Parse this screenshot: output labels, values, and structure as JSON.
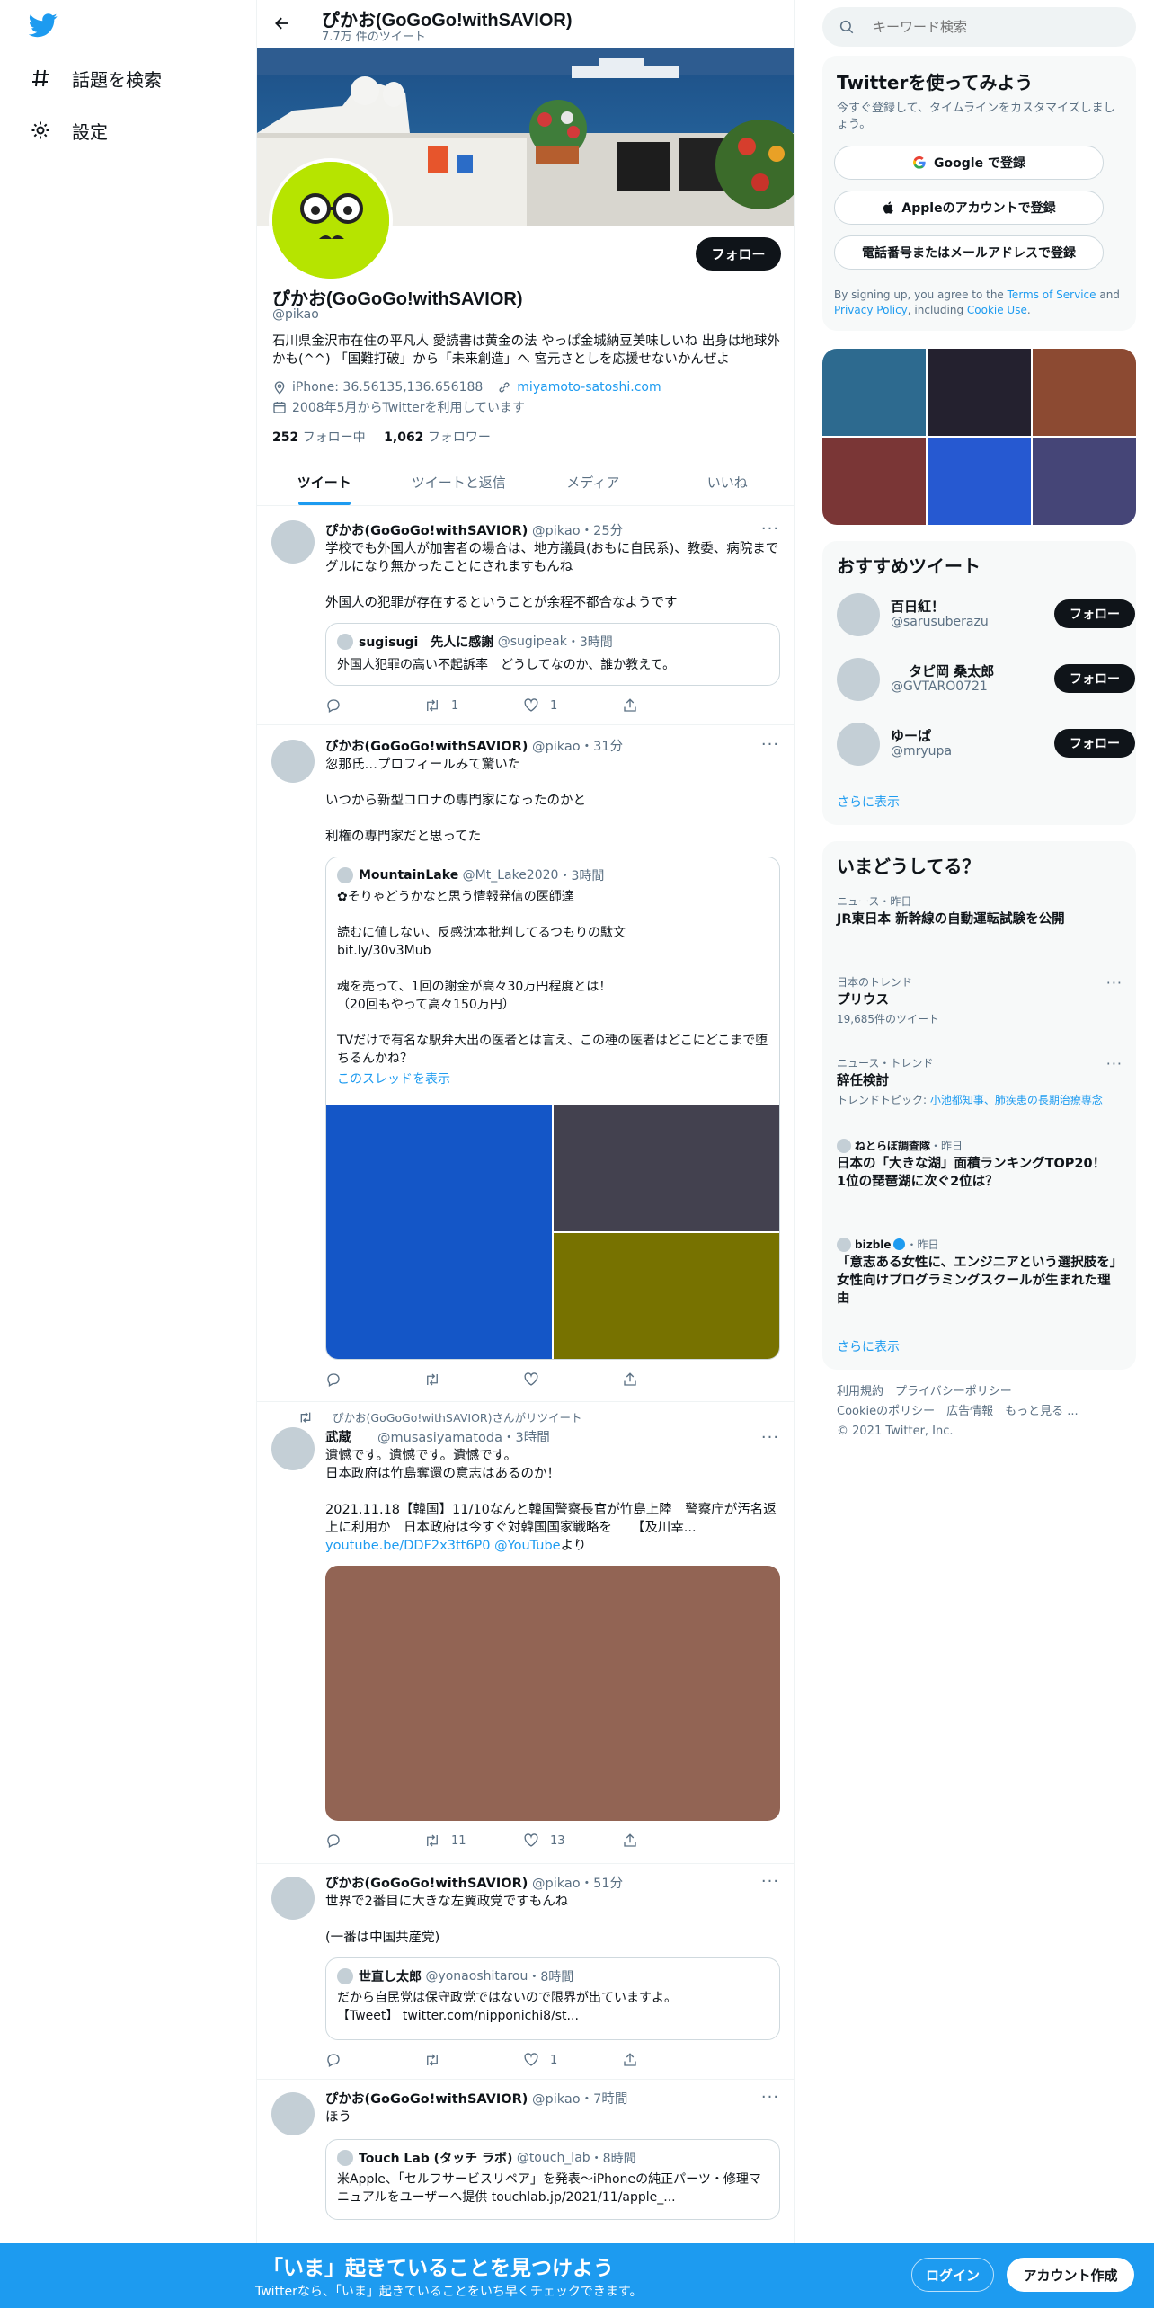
{
  "nav": {
    "explore": "話題を検索",
    "settings": "設定"
  },
  "colors": {
    "accent": "#1d9bf0",
    "text": "#0f1419",
    "muted": "#5b7083"
  },
  "topbar": {
    "title": "ぴかお(GoGoGo!withSAVIOR)",
    "subtitle": "7.7万 件のツイート"
  },
  "profile": {
    "follow": "フォロー",
    "name": "ぴかお(GoGoGo!withSAVIOR)",
    "handle": "@pikao",
    "bio": "石川県金沢市在住の平凡人 愛読書は黄金の法 やっぱ金城納豆美味しいね 出身は地球外かも(^^) 「国難打破」から「未来創造」へ 宮元さとしを応援せないかんぜよ",
    "location": "iPhone: 36.56135,136.656188",
    "website": "miyamoto-satoshi.com",
    "joined": "2008年5月からTwitterを利用しています",
    "following_count": "252",
    "following_label": "フォロー中",
    "followers_count": "1,062",
    "followers_label": "フォロワー"
  },
  "tabs": [
    "ツイート",
    "ツイートと返信",
    "メディア",
    "いいね"
  ],
  "tweets": [
    {
      "name": "ぴかお(GoGoGo!withSAVIOR)",
      "handle": "@pikao",
      "time": "・25分",
      "text": "学校でも外国人が加害者の場合は、地方議員(おもに自民系)、教委、病院までグルになり無かったことにされますもんね\n\n外国人の犯罪が存在するということが余程不都合なようです",
      "quote": {
        "name": "sugisugi　先人に感謝",
        "handle": "@sugipeak",
        "time": "・3時間",
        "text": "外国人犯罪の高い不起訴率　どうしてなのか、誰か教えて。"
      },
      "retweets": "1",
      "likes": "1"
    },
    {
      "name": "ぴかお(GoGoGo!withSAVIOR)",
      "handle": "@pikao",
      "time": "・31分",
      "text": "忽那氏…プロフィールみて驚いた\n\nいつから新型コロナの専門家になったのかと\n\n利権の専門家だと思ってた",
      "quote": {
        "name": "MountainLake",
        "handle": "@Mt_Lake2020",
        "time": "・3時間",
        "text": "✿そりゃどうかなと思う情報発信の医師達\n\n読むに値しない、反感沈本批判してるつもりの駄文\nbit.ly/30v3Mub\n\n魂を売って、1回の謝金が高々30万円程度とは！\n（20回もやって高々150万円）\n\nTVだけで有名な駅弁大出の医者とは言え、この種の医者はどこにどこまで堕ちるんかね？",
        "thread": "このスレッドを表示"
      },
      "retweets": "",
      "likes": ""
    },
    {
      "rtlabel": "ぴかお(GoGoGo!withSAVIOR)さんがリツイート",
      "name": "武蔵",
      "handle": "@musasiyamatoda",
      "time": "・3時間",
      "text": "遺憾です。遺憾です。遺憾です。\n日本政府は竹島奪還の意志はあるのか！\n\n2021.11.18【韓国】11/10なんと韓国警察長官が竹島上陸　警察庁が汚名返上に利用か　日本政府は今すぐ対韓国国家戦略を　　【及川幸...",
      "link": "youtube.be/DDF2x3tt6P0 @YouTube",
      "link_suffix": "より",
      "retweets": "11",
      "likes": "13"
    },
    {
      "name": "ぴかお(GoGoGo!withSAVIOR)",
      "handle": "@pikao",
      "time": "・51分",
      "text": "世界で2番目に大きな左翼政党ですもんね\n\n(一番は中国共産党)",
      "quote": {
        "name": "世直し太郎",
        "handle": "@yonaoshitarou",
        "time": "・8時間",
        "text": "だから自民党は保守政党ではないので限界が出ていますよ。\n【Tweet】 twitter.com/nipponichi8/st..."
      },
      "retweets": "",
      "likes": "1"
    },
    {
      "name": "ぴかお(GoGoGo!withSAVIOR)",
      "handle": "@pikao",
      "time": "・7時間",
      "text": "ほう",
      "quote": {
        "name": "Touch Lab (タッチ ラボ)",
        "handle": "@touch_lab",
        "time": "・8時間",
        "text": "米Apple、「セルフサービスリペア」を発表〜iPhoneの純正パーツ・修理マニュアルをユーザーへ提供 touchlab.jp/2021/11/apple_..."
      }
    }
  ],
  "right": {
    "search_placeholder": "キーワード検索",
    "signup": {
      "title": "Twitterを使ってみよう",
      "sub": "今すぐ登録して、タイムラインをカスタマイズしましょう。",
      "google": "Google で登録",
      "apple": "Appleのアカウントで登録",
      "phone": "電話番号またはメールアドレスで登録",
      "legal_pre": "By signing up, you agree to the ",
      "terms": "Terms of Service",
      "and": " and ",
      "privacy": "Privacy Policy",
      "including": ", including ",
      "cookie": "Cookie Use",
      "period": "."
    },
    "photo_colors": [
      "#2d6a8f",
      "#24212f",
      "#8c4a32",
      "#7a3636",
      "#2659d1",
      "#454577"
    ],
    "recommend": {
      "title": "おすすめツイート",
      "follow": "フォロー",
      "more": "さらに表示",
      "users": [
        {
          "name": "百日紅！",
          "handle": "@sarusuberazu"
        },
        {
          "name": "タピ岡 桑太郎",
          "handle": "@GVTARO0721"
        },
        {
          "name": "ゆーぱ",
          "handle": "@mryupa"
        }
      ]
    },
    "trends": {
      "title": "いまどうしてる？",
      "more": "さらに表示",
      "items": [
        {
          "ctx": "ニュース・昨日",
          "title": "JR東日本 新幹線の自動運転試験を公開"
        },
        {
          "ctx": "日本のトレンド",
          "title": "プリウス",
          "extra": "19,685件のツイート"
        },
        {
          "ctx": "ニュース・トレンド",
          "title": "辞任検討",
          "extra_pre": "トレンドトピック: ",
          "extra_link": "小池都知事、肺疾患の長期治療専念"
        },
        {
          "ctx_name": "ねとらぼ調査隊",
          "ctx": "・昨日",
          "title": "日本の「大きな湖」面積ランキングTOP20！　1位の琵琶湖に次ぐ2位は？"
        },
        {
          "ctx_name": "bizble",
          "ctx": "・昨日",
          "title": "「意志ある女性に、エンジニアという選択肢を」　女性向けプログラミングスクールが生まれた理由"
        }
      ]
    },
    "footer": {
      "line1": "利用規約　プライバシーポリシー",
      "line2": "Cookieのポリシー　広告情報　もっと見る ...",
      "line3": "© 2021 Twitter, Inc."
    }
  },
  "bottom": {
    "title": "「いま」起きていることを見つけよう",
    "sub": "Twitterなら、「いま」起きていることをいち早くチェックできます。",
    "login": "ログイン",
    "signup": "アカウント作成"
  }
}
